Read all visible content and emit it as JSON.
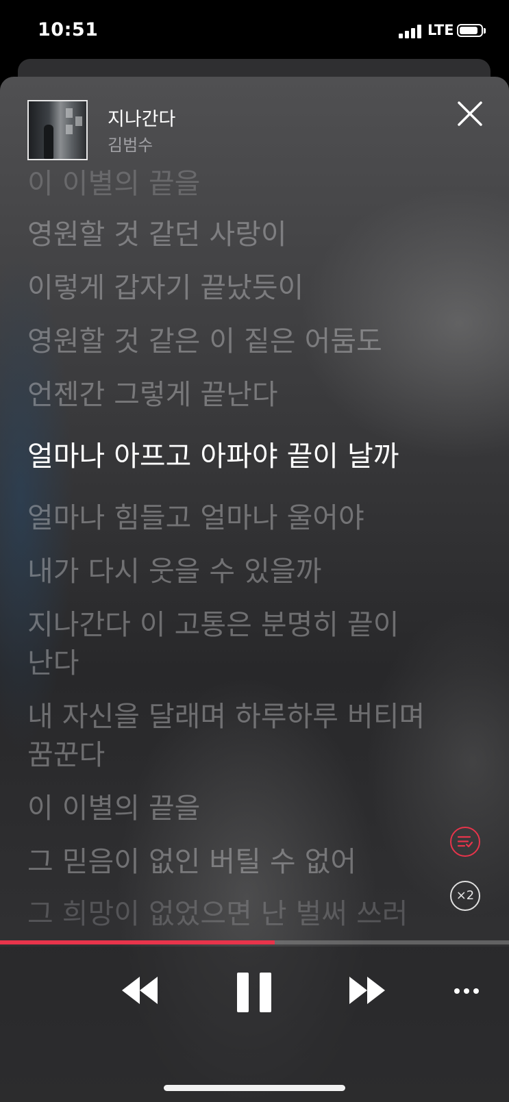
{
  "status_bar": {
    "time": "10:51",
    "network": "LTE",
    "battery_level": 0.85
  },
  "track": {
    "title": "지나간다",
    "artist": "김범수"
  },
  "lyrics": [
    "이 이별의 끝을",
    "영원할 것 같던 사랑이",
    "이렇게 갑자기 끝났듯이",
    "영원할 것 같은 이 짙은 어둠도",
    "언젠간 그렇게 끝난다",
    "얼마나 아프고 아파야 끝이 날까",
    "얼마나 힘들고 얼마나 울어야",
    "내가 다시 웃을 수 있을까",
    "지나간다 이 고통은 분명히 끝이 난다",
    "내 자신을 달래며 하루하루 버티며 꿈꾼다",
    "이 이별의 끝을",
    "그 믿음이 없인 버틸 수 없어",
    "그 희망이 없었으면 난 벌써 쓰러"
  ],
  "current_line_index": 5,
  "speed_label": "×2",
  "playback": {
    "progress_fraction": 0.54,
    "state": "playing"
  },
  "colors": {
    "accent": "#e8344b",
    "active_lyric": "#ffffff",
    "inactive_lyric": "#8e8e93"
  },
  "icons": {
    "close": "close-icon",
    "queue": "queue-icon",
    "rewind": "rewind-icon",
    "pause": "pause-icon",
    "forward": "fast-forward-icon",
    "more": "more-icon"
  }
}
